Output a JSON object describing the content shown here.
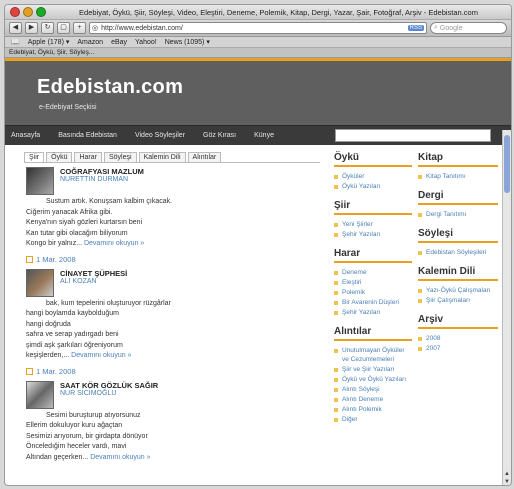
{
  "window": {
    "title": "Edebiyat, Öykü, Şiir, Söyleşi, Video, Eleştiri, Deneme, Polemik, Kitap, Dergi, Yazar, Şair, Fotoğraf, Arşiv - Edebistan.com"
  },
  "toolbar": {
    "url": "http://www.edebistan.com/",
    "rss": "RSS",
    "search_placeholder": "Google"
  },
  "bookmarks": [
    "Apple (178) ▾",
    "Amazon",
    "eBay",
    "Yahoo!",
    "News (1095) ▾"
  ],
  "tab_title": "Edebiyat, Öykü, Şiir, Söyleş...",
  "site": {
    "title": "Edebistan.com",
    "tagline": "e-Edebiyat Seçkisi"
  },
  "nav": [
    "Anasayfa",
    "Basında Edebistan",
    "Video Söyleşiler",
    "Göz Kırası",
    "Künye"
  ],
  "content_tabs": [
    "Şiir",
    "Öykü",
    "Harar",
    "Söyleşi",
    "Kalemin Dili",
    "Alıntılar"
  ],
  "posts": [
    {
      "title": "COĞRAFYASI MAZLUM",
      "author": "NURETTİN DURMAN",
      "lines": [
        "Sustum artık. Konuşsam kalbim çıkacak.",
        "Ciğerim yanacak Afrika gibi.",
        "Kenya'nın siyah gözleri kurtarsın beni",
        "Kan tutar gibi olacağım biliyorum",
        "Kongo bir yalnız..."
      ],
      "more": "Devamını okuyun »",
      "date": "1 Mar. 2008"
    },
    {
      "title": "CİNAYET ŞÜPHESİ",
      "author": "ALİ KOZAN",
      "lines": [
        "bak, kum tepelerini oluşturuyor rüzgârlar",
        "hangi boylamda kaybolduğum",
        "hangi doğruda",
        "sahra ve serap yadırgadı beni",
        "şimdi aşk şarkıları öğreniyorum",
        "keşişlerden,..."
      ],
      "more": "Devamını okuyun »",
      "date": "1 Mar. 2008"
    },
    {
      "title": "SAAT KÖR GÖZLÜK SAĞIR",
      "author": "NUR SİCİMOĞLU",
      "lines": [
        "Sesimi buruşturup atıyorsunuz",
        "Ellerim dokuluyor kuru ağaçtan",
        "Sesimizi arıyorum, bir girdapta dönüyor",
        "Önceledığim heceler vardı, mavi",
        "Altından geçerken..."
      ],
      "more": "Devamını okuyun »",
      "date": ""
    }
  ],
  "sidebar_mid": [
    {
      "title": "Öykü",
      "items": [
        "Öyküler",
        "Öykü Yazıları"
      ]
    },
    {
      "title": "Şiir",
      "items": [
        "Yeni Şiirler",
        "Şehir Yazıları"
      ]
    },
    {
      "title": "Harar",
      "items": [
        "Deneme",
        "Eleştiri",
        "Polemik",
        "Bir Avarenin Düşleri",
        "Şehir Yazıları"
      ]
    },
    {
      "title": "Alıntılar",
      "items": [
        "Unutulmayan Öyküler ve Cezumlemeleri",
        "Şiir ve Şiir Yazıları",
        "Öykü ve Öykü Yazıları",
        "Alıntı Söyleşi",
        "Alıntı Deneme",
        "Alıntı Polemik",
        "Diğer"
      ]
    }
  ],
  "sidebar_right": [
    {
      "title": "Kitap",
      "items": [
        "Kitap Tanıtımı"
      ]
    },
    {
      "title": "Dergi",
      "items": [
        "Dergi Tanıtımı"
      ]
    },
    {
      "title": "Söyleşi",
      "items": [
        "Edebistan Söyleşileri"
      ]
    },
    {
      "title": "Kalemin Dili",
      "items": [
        "Yazı-Öykü Çalışmaları",
        "Şiir Çalışmaları"
      ]
    },
    {
      "title": "Arşiv",
      "items": [
        "2008",
        "2007"
      ]
    }
  ]
}
